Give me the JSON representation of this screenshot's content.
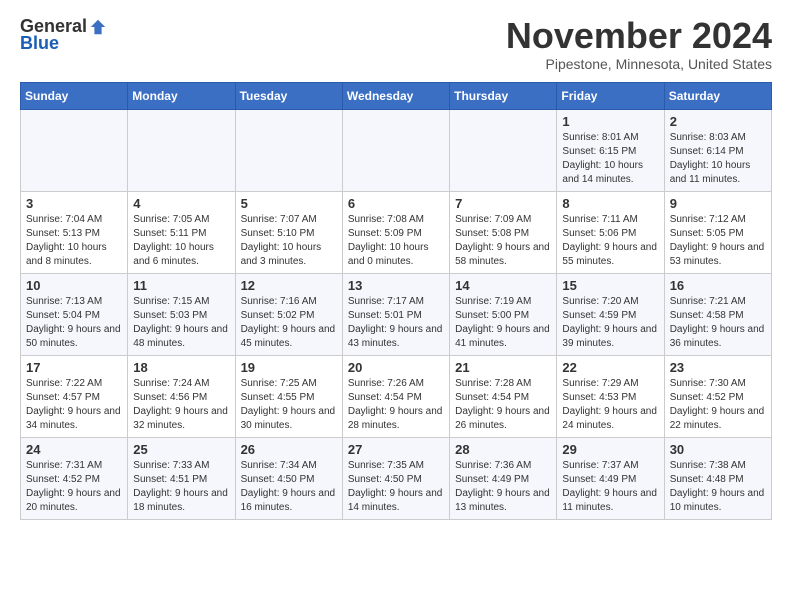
{
  "header": {
    "logo_general": "General",
    "logo_blue": "Blue",
    "month_title": "November 2024",
    "location": "Pipestone, Minnesota, United States"
  },
  "weekdays": [
    "Sunday",
    "Monday",
    "Tuesday",
    "Wednesday",
    "Thursday",
    "Friday",
    "Saturday"
  ],
  "weeks": [
    [
      {
        "day": "",
        "info": ""
      },
      {
        "day": "",
        "info": ""
      },
      {
        "day": "",
        "info": ""
      },
      {
        "day": "",
        "info": ""
      },
      {
        "day": "",
        "info": ""
      },
      {
        "day": "1",
        "info": "Sunrise: 8:01 AM\nSunset: 6:15 PM\nDaylight: 10 hours and 14 minutes."
      },
      {
        "day": "2",
        "info": "Sunrise: 8:03 AM\nSunset: 6:14 PM\nDaylight: 10 hours and 11 minutes."
      }
    ],
    [
      {
        "day": "3",
        "info": "Sunrise: 7:04 AM\nSunset: 5:13 PM\nDaylight: 10 hours and 8 minutes."
      },
      {
        "day": "4",
        "info": "Sunrise: 7:05 AM\nSunset: 5:11 PM\nDaylight: 10 hours and 6 minutes."
      },
      {
        "day": "5",
        "info": "Sunrise: 7:07 AM\nSunset: 5:10 PM\nDaylight: 10 hours and 3 minutes."
      },
      {
        "day": "6",
        "info": "Sunrise: 7:08 AM\nSunset: 5:09 PM\nDaylight: 10 hours and 0 minutes."
      },
      {
        "day": "7",
        "info": "Sunrise: 7:09 AM\nSunset: 5:08 PM\nDaylight: 9 hours and 58 minutes."
      },
      {
        "day": "8",
        "info": "Sunrise: 7:11 AM\nSunset: 5:06 PM\nDaylight: 9 hours and 55 minutes."
      },
      {
        "day": "9",
        "info": "Sunrise: 7:12 AM\nSunset: 5:05 PM\nDaylight: 9 hours and 53 minutes."
      }
    ],
    [
      {
        "day": "10",
        "info": "Sunrise: 7:13 AM\nSunset: 5:04 PM\nDaylight: 9 hours and 50 minutes."
      },
      {
        "day": "11",
        "info": "Sunrise: 7:15 AM\nSunset: 5:03 PM\nDaylight: 9 hours and 48 minutes."
      },
      {
        "day": "12",
        "info": "Sunrise: 7:16 AM\nSunset: 5:02 PM\nDaylight: 9 hours and 45 minutes."
      },
      {
        "day": "13",
        "info": "Sunrise: 7:17 AM\nSunset: 5:01 PM\nDaylight: 9 hours and 43 minutes."
      },
      {
        "day": "14",
        "info": "Sunrise: 7:19 AM\nSunset: 5:00 PM\nDaylight: 9 hours and 41 minutes."
      },
      {
        "day": "15",
        "info": "Sunrise: 7:20 AM\nSunset: 4:59 PM\nDaylight: 9 hours and 39 minutes."
      },
      {
        "day": "16",
        "info": "Sunrise: 7:21 AM\nSunset: 4:58 PM\nDaylight: 9 hours and 36 minutes."
      }
    ],
    [
      {
        "day": "17",
        "info": "Sunrise: 7:22 AM\nSunset: 4:57 PM\nDaylight: 9 hours and 34 minutes."
      },
      {
        "day": "18",
        "info": "Sunrise: 7:24 AM\nSunset: 4:56 PM\nDaylight: 9 hours and 32 minutes."
      },
      {
        "day": "19",
        "info": "Sunrise: 7:25 AM\nSunset: 4:55 PM\nDaylight: 9 hours and 30 minutes."
      },
      {
        "day": "20",
        "info": "Sunrise: 7:26 AM\nSunset: 4:54 PM\nDaylight: 9 hours and 28 minutes."
      },
      {
        "day": "21",
        "info": "Sunrise: 7:28 AM\nSunset: 4:54 PM\nDaylight: 9 hours and 26 minutes."
      },
      {
        "day": "22",
        "info": "Sunrise: 7:29 AM\nSunset: 4:53 PM\nDaylight: 9 hours and 24 minutes."
      },
      {
        "day": "23",
        "info": "Sunrise: 7:30 AM\nSunset: 4:52 PM\nDaylight: 9 hours and 22 minutes."
      }
    ],
    [
      {
        "day": "24",
        "info": "Sunrise: 7:31 AM\nSunset: 4:52 PM\nDaylight: 9 hours and 20 minutes."
      },
      {
        "day": "25",
        "info": "Sunrise: 7:33 AM\nSunset: 4:51 PM\nDaylight: 9 hours and 18 minutes."
      },
      {
        "day": "26",
        "info": "Sunrise: 7:34 AM\nSunset: 4:50 PM\nDaylight: 9 hours and 16 minutes."
      },
      {
        "day": "27",
        "info": "Sunrise: 7:35 AM\nSunset: 4:50 PM\nDaylight: 9 hours and 14 minutes."
      },
      {
        "day": "28",
        "info": "Sunrise: 7:36 AM\nSunset: 4:49 PM\nDaylight: 9 hours and 13 minutes."
      },
      {
        "day": "29",
        "info": "Sunrise: 7:37 AM\nSunset: 4:49 PM\nDaylight: 9 hours and 11 minutes."
      },
      {
        "day": "30",
        "info": "Sunrise: 7:38 AM\nSunset: 4:48 PM\nDaylight: 9 hours and 10 minutes."
      }
    ]
  ]
}
